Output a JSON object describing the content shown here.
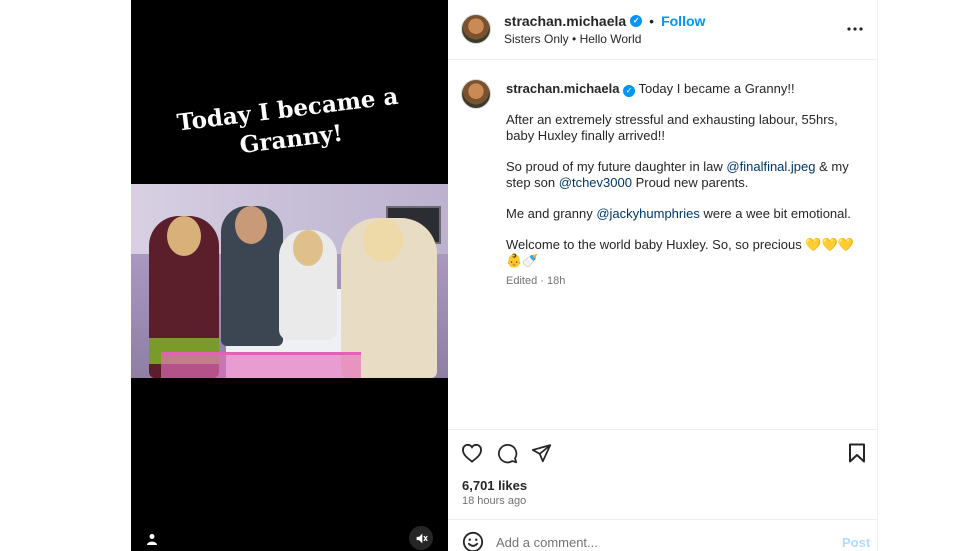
{
  "media": {
    "overlay_title_line1": "Today I became a",
    "overlay_title_line2": "Granny!",
    "tagged_icon": "person-icon",
    "mute_icon": "speaker-muted-icon"
  },
  "header": {
    "username": "strachan.michaela",
    "verified_icon": "verified-badge-icon",
    "separator": "•",
    "follow_label": "Follow",
    "audio_artist": "Sisters Only",
    "audio_separator": "•",
    "audio_title": "Hello World",
    "more_icon": "more-options-icon"
  },
  "caption": {
    "username": "strachan.michaela",
    "headline": "Today I became a Granny!!",
    "para1": "After an extremely stressful and exhausting labour, 55hrs, baby Huxley finally arrived!!",
    "para2_a": "So proud of my future daughter in law ",
    "para2_mention1": "@finalfinal.jpeg",
    "para2_b": " & my step son ",
    "para2_mention2": "@tchev3000",
    "para2_c": " Proud new parents.",
    "para3_a": "Me and granny ",
    "para3_mention": "@jackyhumphries",
    "para3_b": " were a wee bit emotional.",
    "para4": "Welcome to the world baby Huxley. So, so precious 💛💛💛👶🍼",
    "para4_line2": "👶🍼",
    "edited_label": "Edited",
    "edited_sep": "·",
    "edited_time": "18h"
  },
  "actions": {
    "like_icon": "heart-icon",
    "comment_icon": "comment-icon",
    "share_icon": "send-icon",
    "save_icon": "bookmark-icon"
  },
  "stats": {
    "likes": "6,701 likes",
    "time_ago": "18 hours ago"
  },
  "comment": {
    "emoji_icon": "emoji-icon",
    "placeholder": "Add a comment...",
    "post_label": "Post"
  },
  "colors": {
    "accent": "#0095f6",
    "mention": "#00376b",
    "muted": "#737373",
    "post_disabled": "#b3dbff"
  }
}
